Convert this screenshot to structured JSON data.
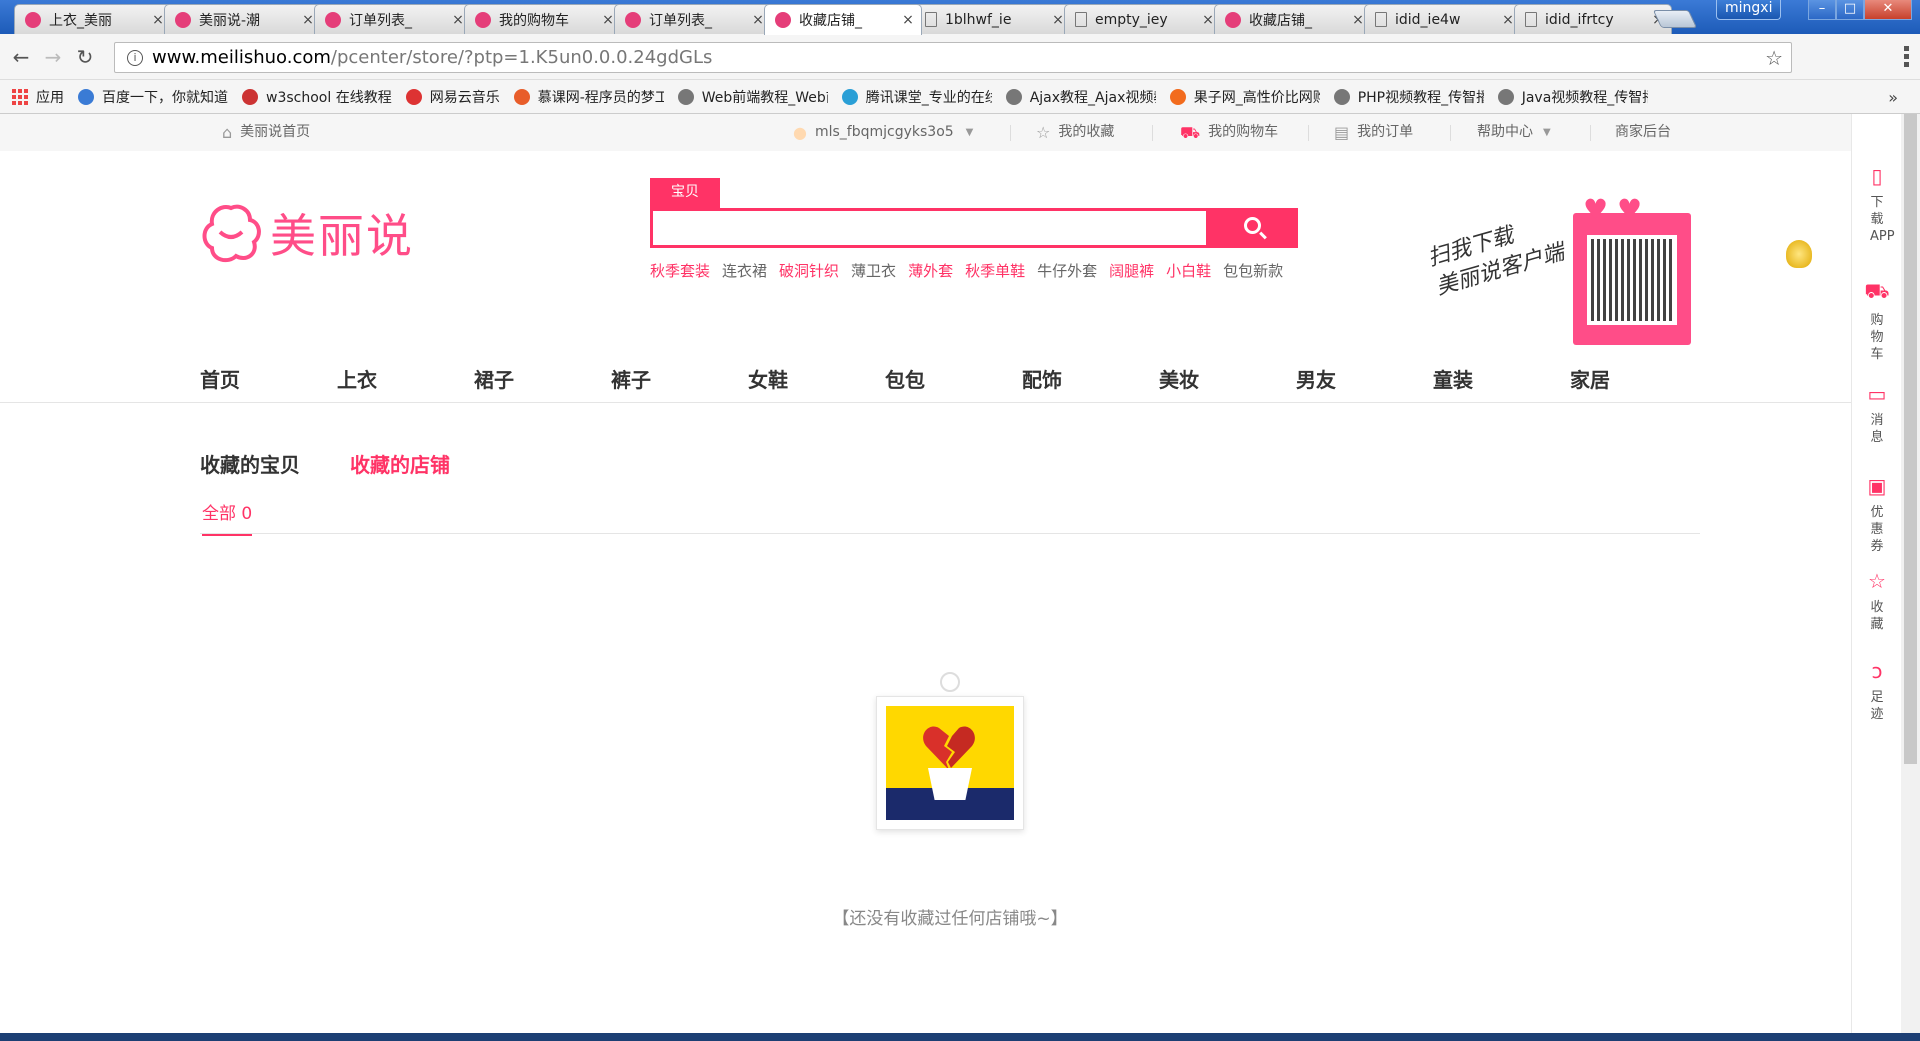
{
  "browser": {
    "tabs": [
      {
        "title": "上衣_美丽",
        "icon": "meilishuo-icon"
      },
      {
        "title": "美丽说-潮",
        "icon": "meilishuo-icon"
      },
      {
        "title": "订单列表_",
        "icon": "meilishuo-icon"
      },
      {
        "title": "我的购物车",
        "icon": "meilishuo-icon"
      },
      {
        "title": "订单列表_",
        "icon": "meilishuo-icon"
      },
      {
        "title": "收藏店铺_",
        "icon": "meilishuo-icon"
      },
      {
        "title": "1blhwf_ie",
        "icon": "document-icon"
      },
      {
        "title": "empty_iey",
        "icon": "document-icon"
      },
      {
        "title": "收藏店铺_",
        "icon": "meilishuo-icon"
      },
      {
        "title": "idid_ie4w",
        "icon": "document-icon"
      },
      {
        "title": "idid_ifrtcy",
        "icon": "document-icon"
      }
    ],
    "active_tab": 5,
    "close_glyph": "×",
    "user": "mingxi",
    "url_host": "www.meilishuo.com",
    "url_path": "/pcenter/store/?ptp=1.K5un0.0.0.24gdGLs",
    "bookmarks": [
      "应用",
      "百度一下，你就知道",
      "w3school 在线教程",
      "网易云音乐",
      "慕课网-程序员的梦工",
      "Web前端教程_Web前",
      "腾讯课堂_专业的在线",
      "Ajax教程_Ajax视频教",
      "果子网_高性价比网购",
      "PHP视频教程_传智播",
      "Java视频教程_传智播"
    ],
    "more": "»"
  },
  "topbar": {
    "home": "美丽说首页",
    "username": "mls_fbqmjcgyks3o5",
    "favorites": "我的收藏",
    "cart": "我的购物车",
    "orders": "我的订单",
    "help": "帮助中心",
    "seller": "商家后台"
  },
  "logo_text": "美丽说",
  "search": {
    "tab_label": "宝贝",
    "value": "",
    "hot_words": [
      {
        "text": "秋季套装",
        "pink": true
      },
      {
        "text": "连衣裙",
        "pink": false
      },
      {
        "text": "破洞针织",
        "pink": true
      },
      {
        "text": "薄卫衣",
        "pink": false
      },
      {
        "text": "薄外套",
        "pink": true
      },
      {
        "text": "秋季单鞋",
        "pink": true
      },
      {
        "text": "牛仔外套",
        "pink": false
      },
      {
        "text": "阔腿裤",
        "pink": true
      },
      {
        "text": "小白鞋",
        "pink": true
      },
      {
        "text": "包包新款",
        "pink": false
      }
    ]
  },
  "qr": {
    "line1": "扫我下载",
    "line2": "美丽说客户端"
  },
  "nav": [
    "首页",
    "上衣",
    "裙子",
    "裤子",
    "女鞋",
    "包包",
    "配饰",
    "美妆",
    "男友",
    "童装",
    "家居"
  ],
  "favorites_page": {
    "tab_items": "收藏的宝贝",
    "tab_shops": "收藏的店铺",
    "sub_all": "全部 0",
    "empty_message": "【还没有收藏过任何店铺哦~】"
  },
  "sidebar": [
    {
      "label": "下载APP",
      "icon": "phone-icon"
    },
    {
      "label": "购物车",
      "icon": "cart-icon"
    },
    {
      "label": "消息",
      "icon": "message-icon"
    },
    {
      "label": "优惠券",
      "icon": "coupon-icon"
    },
    {
      "label": "收藏",
      "icon": "star-icon"
    },
    {
      "label": "足迹",
      "icon": "footprint-icon"
    }
  ],
  "colors": {
    "brand": "#ff3366",
    "logo": "#ff4d88"
  }
}
